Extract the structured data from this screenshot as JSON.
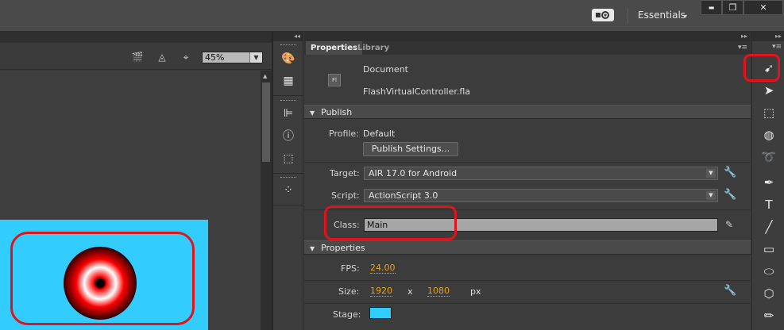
{
  "app": {
    "workspace_label": "Essentials",
    "workspace_caret": "▾",
    "window_buttons": {
      "minimize": "▬",
      "restore": "❐",
      "close": "✕"
    }
  },
  "stage": {
    "zoom_value": "45%",
    "zoom_caret": "▼",
    "canvas_color": "#33ccff",
    "icons": [
      "clapper-icon",
      "symbol-icon",
      "center-stage-icon"
    ]
  },
  "panel": {
    "tabs": [
      {
        "label": "Properties"
      },
      {
        "label": "Library"
      }
    ],
    "document": {
      "icon_text": "Fl",
      "type_label": "Document",
      "file_name": "FlashVirtualController.fla"
    },
    "publish": {
      "section_label": "Publish",
      "profile_label": "Profile:",
      "profile_value": "Default",
      "publish_settings_label": "Publish Settings...",
      "target_label": "Target:",
      "target_value": "AIR 17.0 for Android",
      "script_label": "Script:",
      "script_value": "ActionScript 3.0",
      "class_label": "Class:",
      "class_value": "Main"
    },
    "properties": {
      "section_label": "Properties",
      "fps_label": "FPS:",
      "fps_value": "24.00",
      "size_label": "Size:",
      "width_value": "1920",
      "times": "x",
      "height_value": "1080",
      "unit": "px",
      "stage_label": "Stage:",
      "stage_color": "#33ccff"
    }
  },
  "annotation_color": "#e0141c"
}
